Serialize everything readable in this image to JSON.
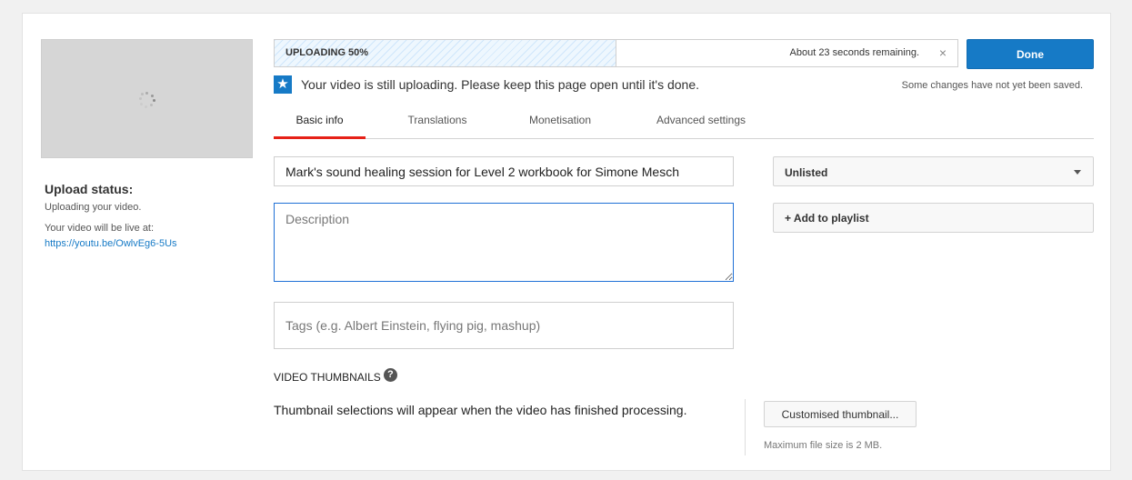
{
  "sidebar": {
    "upload_status_title": "Upload status:",
    "upload_status_text": "Uploading your video.",
    "live_text": "Your video will be live at:",
    "live_url": "https://youtu.be/OwlvEg6-5Us"
  },
  "progress": {
    "label": "UPLOADING 50%",
    "percent": 50,
    "remaining": "About 23 seconds remaining.",
    "close_glyph": "×"
  },
  "done_label": "Done",
  "notice": {
    "star_glyph": "★",
    "message": "Your video is still uploading. Please keep this page open until it's done."
  },
  "unsaved_text": "Some changes have not yet been saved.",
  "tabs": [
    {
      "label": "Basic info",
      "active": true
    },
    {
      "label": "Translations",
      "active": false
    },
    {
      "label": "Monetisation",
      "active": false
    },
    {
      "label": "Advanced settings",
      "active": false
    }
  ],
  "form": {
    "title_value": "Mark's sound healing session for Level 2 workbook for Simone Mesch",
    "description_placeholder": "Description",
    "tags_placeholder": "Tags (e.g. Albert Einstein, flying pig, mashup)",
    "privacy_value": "Unlisted",
    "add_playlist_label": "+ Add to playlist"
  },
  "thumbnails": {
    "title": "VIDEO THUMBNAILS",
    "help_glyph": "?",
    "info_text": "Thumbnail selections will appear when the video has finished processing.",
    "custom_button": "Customised thumbnail...",
    "max_size": "Maximum file size is 2 MB."
  },
  "colors": {
    "accent": "#167ac6",
    "active_tab_underline": "#e62117"
  }
}
